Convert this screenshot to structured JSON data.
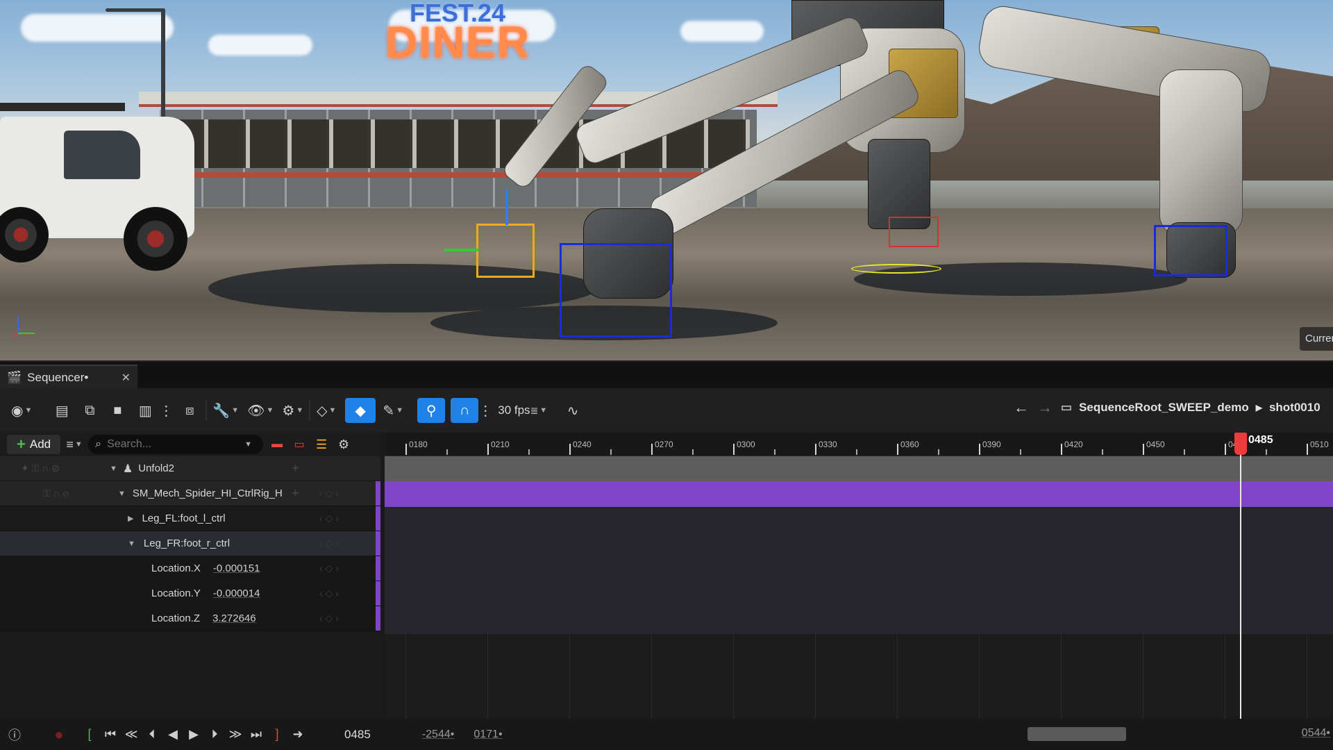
{
  "viewport": {
    "diner_sign": "DINER",
    "diner_sign_top": "FEST.24",
    "overlay_label": "Current"
  },
  "tab": {
    "title": "Sequencer•"
  },
  "toolbar": {
    "fps": "30 fps",
    "breadcrumb": [
      "SequenceRoot_SWEEP_demo",
      "shot0010"
    ]
  },
  "filterbar": {
    "add_label": "Add",
    "search_placeholder": "Search..."
  },
  "outliner": {
    "rows": [
      {
        "label": "Unfold2",
        "value": ""
      },
      {
        "label": "SM_Mech_Spider_HI_CtrlRig_H",
        "value": ""
      },
      {
        "label": "Leg_FL:foot_l_ctrl",
        "value": ""
      },
      {
        "label": "Leg_FR:foot_r_ctrl",
        "value": ""
      },
      {
        "label": "Location.X",
        "value": "-0.000151"
      },
      {
        "label": "Location.Y",
        "value": "-0.000014"
      },
      {
        "label": "Location.Z",
        "value": "3.272646"
      }
    ]
  },
  "timeline": {
    "ticks": [
      "0180",
      "0210",
      "0240",
      "0270",
      "0300",
      "0330",
      "0360",
      "0390",
      "0420",
      "0450",
      "0480",
      "0510"
    ],
    "playhead_frame": "0485"
  },
  "transport": {
    "current_frame": "0485",
    "range_start": "-2544•",
    "range_view_start": "0171•",
    "range_end": "0544•"
  },
  "colors": {
    "accent_blue": "#1e82e6",
    "track_purple": "#7f45c9",
    "playhead_red": "#ee3b3b"
  }
}
